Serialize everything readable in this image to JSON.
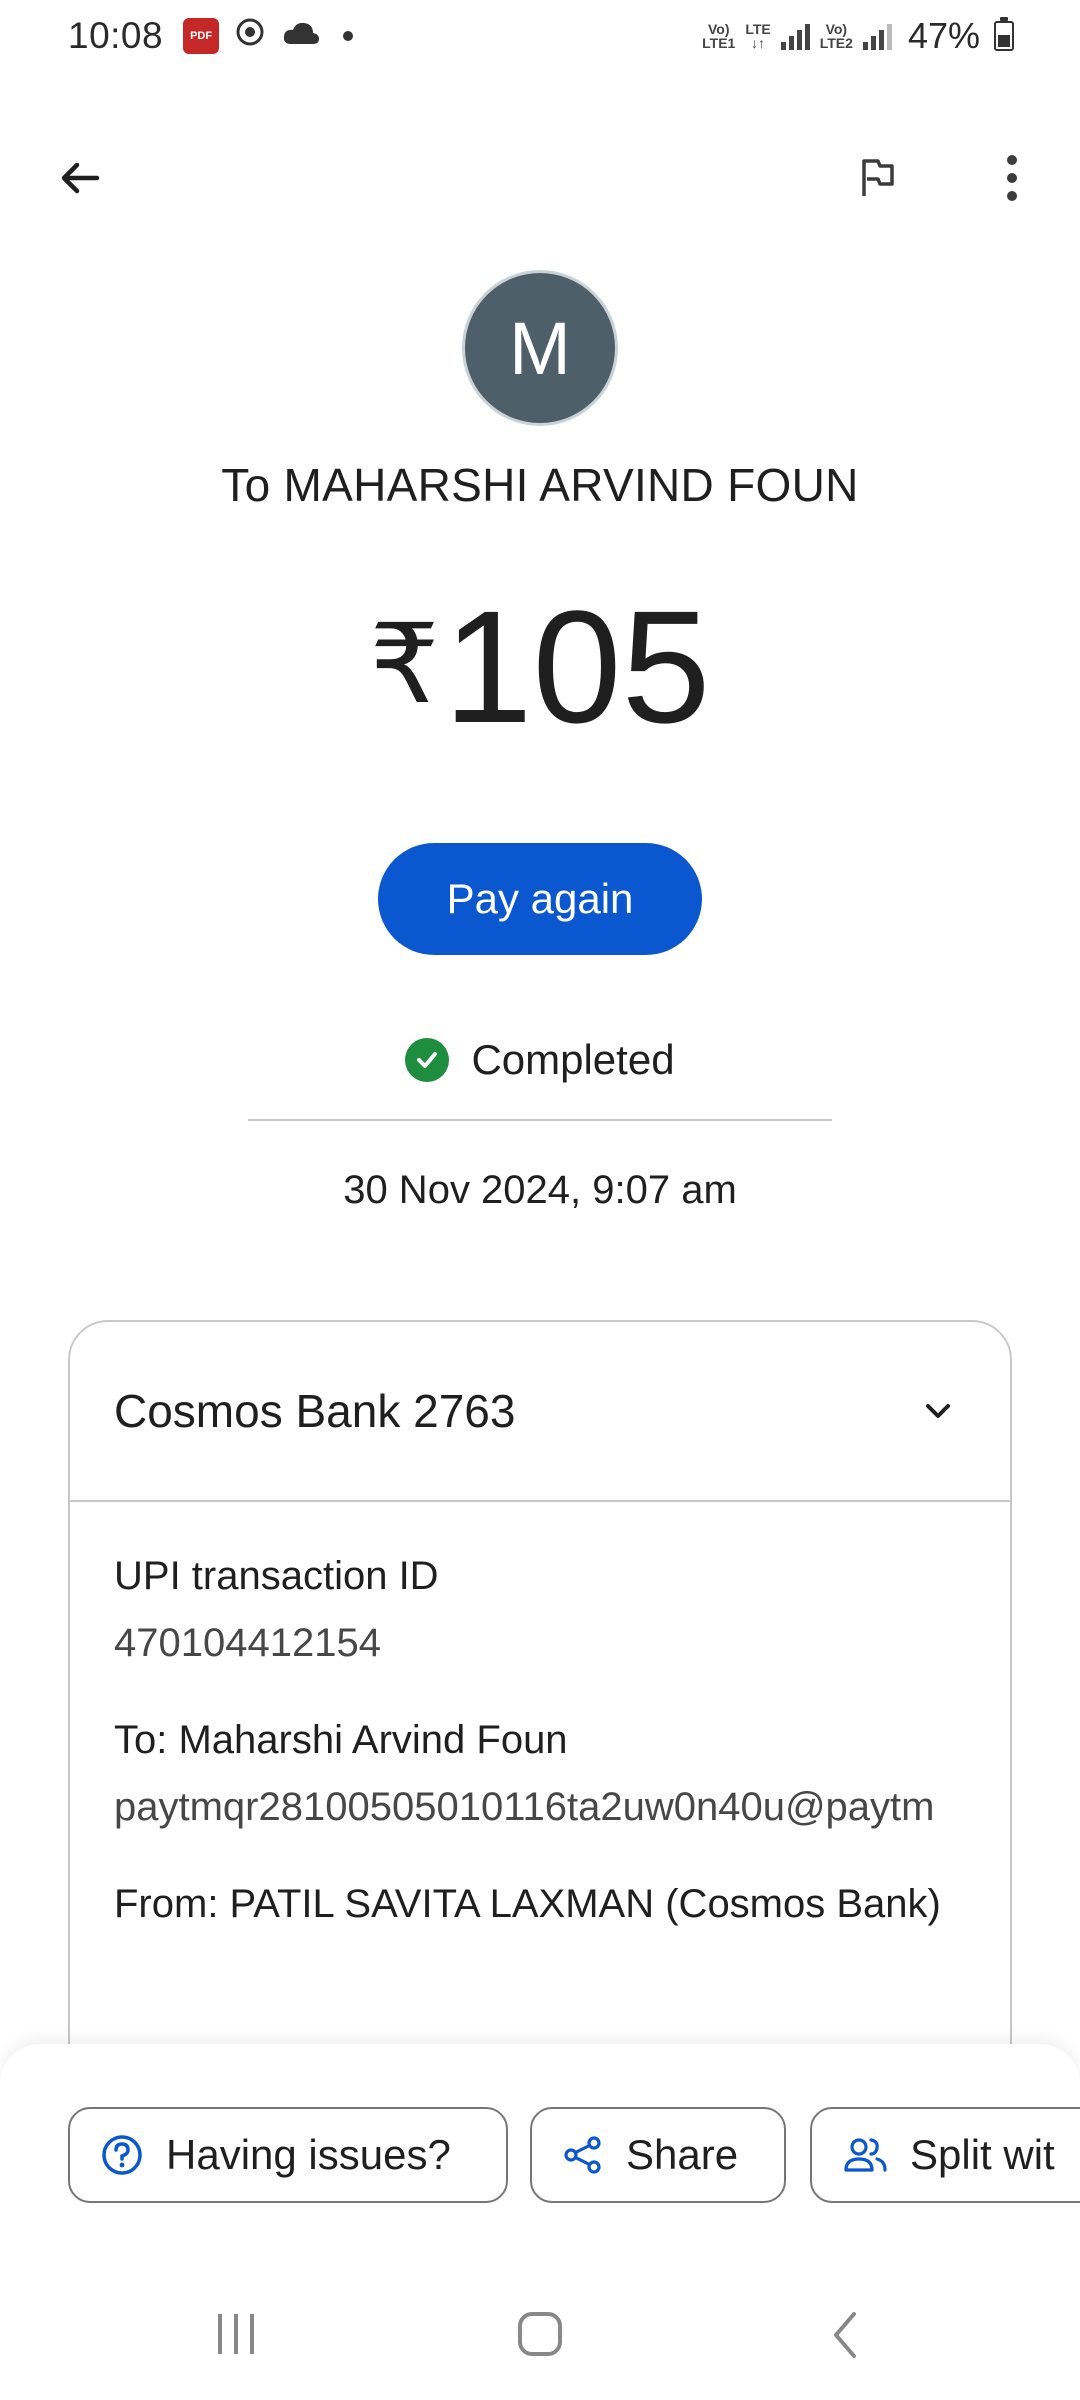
{
  "status_bar": {
    "time": "10:08",
    "pdf_badge": "PDF",
    "net1": [
      "Vo)",
      "LTE1"
    ],
    "net_lte": [
      "LTE",
      "↓↑"
    ],
    "net2": [
      "Vo)",
      "LTE2"
    ],
    "battery": "47%"
  },
  "icons": {
    "back": "arrow-left-icon",
    "report": "flag-icon",
    "more": "more-vert-icon",
    "status": "check-circle-icon",
    "expand": "chevron-down-icon",
    "help": "help-circle-icon",
    "share": "share-icon",
    "split": "people-icon"
  },
  "payee": {
    "avatar_initial": "M",
    "title": "To MAHARSHI ARVIND FOUN"
  },
  "amount": {
    "currency": "₹",
    "value": "105"
  },
  "actions": {
    "pay_again": "Pay again"
  },
  "status": {
    "label": "Completed",
    "datetime": "30 Nov 2024, 9:07 am"
  },
  "card": {
    "bank": "Cosmos Bank 2763",
    "fields": [
      {
        "label": "UPI transaction ID",
        "value": "470104412154"
      },
      {
        "label": "To: Maharshi Arvind Foun",
        "value": "paytmqr28100505010116ta2uw0n40u@paytm"
      },
      {
        "label": "From: PATIL SAVITA LAXMAN (Cosmos Bank)",
        "value": ""
      }
    ]
  },
  "bottom_actions": {
    "issues": "Having issues?",
    "share": "Share",
    "split": "Split wit"
  },
  "colors": {
    "primary": "#0b57d0",
    "success": "#1e8e3e",
    "avatar": "#4f5f6a"
  }
}
